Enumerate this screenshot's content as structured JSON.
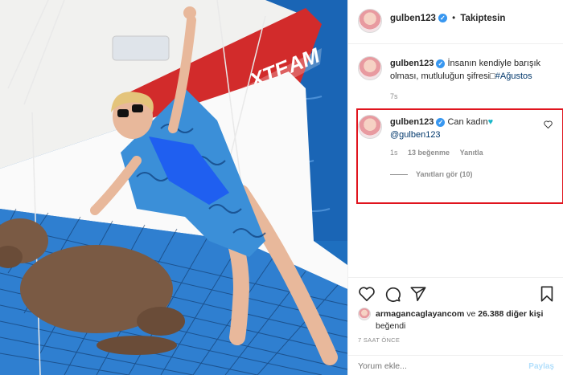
{
  "post": {
    "author": "gulben123",
    "verified_mark": "✓",
    "follow_status": "Takiptesin",
    "separator": "•"
  },
  "caption": {
    "author": "gulben123",
    "text": " İnsanın kendiyle barışık olması, mutluluğun şifresi□",
    "hashtag": "#Ağustos",
    "time": "7s"
  },
  "comment": {
    "author": "gulben123",
    "text": " Can kadın",
    "heart": "♥",
    "mention": "@gulben123",
    "time": "1s",
    "likes": "13 beğenme",
    "reply_label": "Yanıtla",
    "view_replies": "Yanıtları gör (10)",
    "like_icon": "heart-outline-icon"
  },
  "actions": {
    "like": "heart-outline-icon",
    "comment": "comment-bubble-icon",
    "share": "paper-plane-icon",
    "save": "bookmark-icon"
  },
  "likes": {
    "first_user": "armagancaglayancom",
    "connector": " ve ",
    "others": "26.388 diğer kişi",
    "suffix": "beğendi"
  },
  "timestamp": "7 SAAT ÖNCE",
  "add_comment": {
    "placeholder": "Yorum ekle...",
    "post_label": "Paylaş"
  },
  "colors": {
    "highlight_border": "#e0141e",
    "verified": "#3897f0",
    "link": "#00376b",
    "muted": "#8e8e8e",
    "post_button": "#b2dffc"
  },
  "photo": {
    "boat_text": "XTEAM TURX",
    "alt_subject": "woman in blue swimsuit and patterned kimono on catamaran net with dog"
  }
}
